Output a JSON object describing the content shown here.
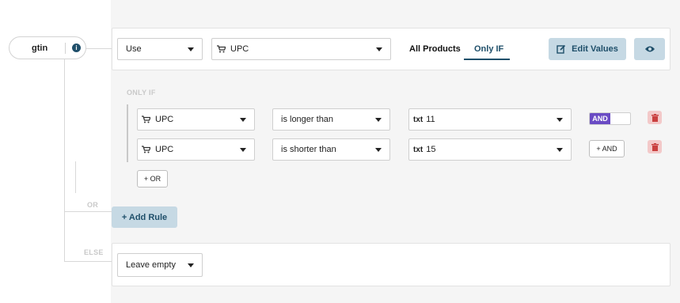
{
  "field": {
    "name": "gtin",
    "info_icon": "info-icon"
  },
  "main_rule": {
    "mode_select": "Use",
    "source_select": "UPC",
    "tabs": [
      "All Products",
      "Only IF"
    ],
    "active_tab": "Only IF",
    "edit_values_label": "Edit Values",
    "preview_icon": "eye-icon"
  },
  "only_if_label": "ONLY IF",
  "conditions": [
    {
      "field": "UPC",
      "operator": "is longer than",
      "value_prefix": "txt",
      "value": "11",
      "connector": "AND"
    },
    {
      "field": "UPC",
      "operator": "is shorter than",
      "value_prefix": "txt",
      "value": "15",
      "connector": "+ AND"
    }
  ],
  "or_button": "+ OR",
  "or_label": "OR",
  "add_rule_label": "+ Add Rule",
  "else_label": "ELSE",
  "else_select": "Leave empty",
  "colors": {
    "accent": "#1f4f6a",
    "button_bg": "#c6d9e4",
    "and_badge": "#6a4bc4",
    "trash_bg": "#f3c9c9",
    "trash_icon": "#c9403f",
    "info": "#1f4f6a"
  }
}
